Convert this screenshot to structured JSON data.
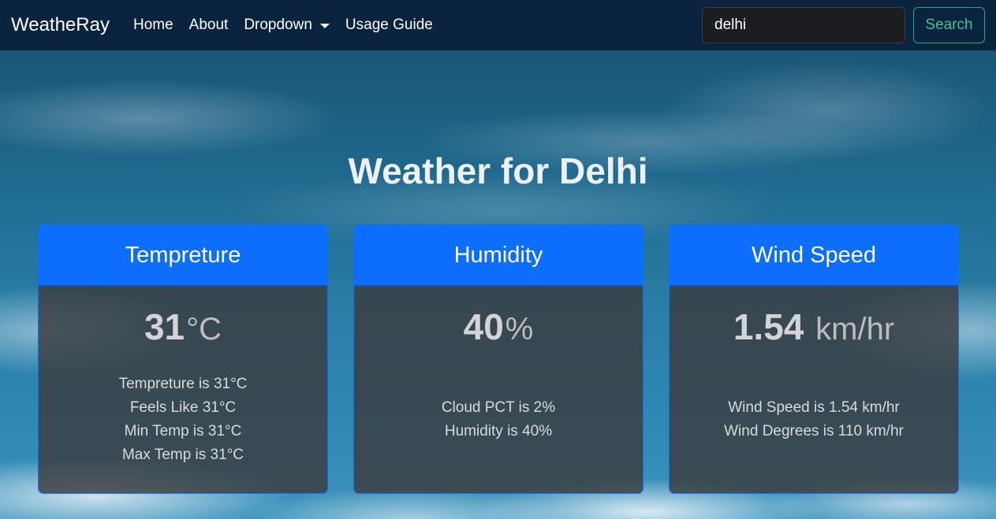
{
  "navbar": {
    "brand": "WeatheRay",
    "links": [
      "Home",
      "About",
      "Dropdown",
      "Usage Guide"
    ],
    "search_value": "delhi",
    "search_button": "Search"
  },
  "page_title": "Weather for Delhi",
  "cards": [
    {
      "title": "Tempreture",
      "value": "31",
      "unit": "°C",
      "details": [
        "Tempreture is 31°C",
        "Feels Like 31°C",
        "Min Temp is 31°C",
        "Max Temp is 31°C"
      ]
    },
    {
      "title": "Humidity",
      "value": "40",
      "unit": "%",
      "details": [
        "Cloud PCT is 2%",
        "Humidity is 40%"
      ]
    },
    {
      "title": "Wind Speed",
      "value": "1.54",
      "unit": "km/hr",
      "details": [
        "Wind Speed is 1.54 km/hr",
        "Wind Degrees is 110 km/hr"
      ]
    }
  ],
  "colors": {
    "navbar_bg": "#0a2440",
    "card_header": "#0d6efd",
    "search_button": "#3ec58f"
  }
}
